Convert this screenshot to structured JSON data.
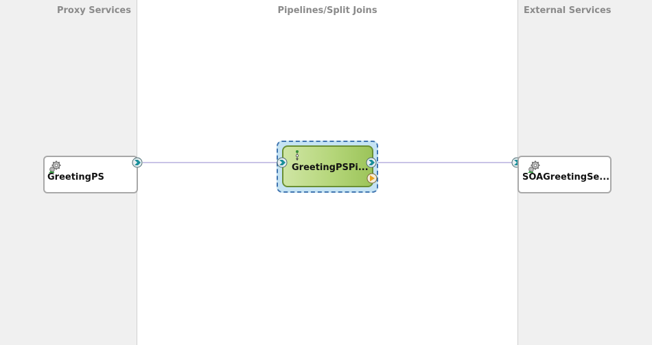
{
  "lanes": {
    "proxy_title": "Proxy Services",
    "pipelines_title": "Pipelines/Split Joins",
    "external_title": "External Services"
  },
  "proxy_service": {
    "name": "GreetingPS",
    "icon": "gear-icon"
  },
  "pipeline": {
    "name": "GreetingPSPi...",
    "icon": "pipeline-icon"
  },
  "external_service": {
    "name": "SOAGreetingSe...",
    "icon": "gear-icon"
  },
  "colors": {
    "lane_bg": "#f0f0f0",
    "canvas_bg": "#ffffff",
    "wire": "#c9c3e6",
    "pipeline_fill": "#b5d67a",
    "selection_fill": "#c5e3f3",
    "selection_border": "#3f74b0",
    "port_teal": "#1a8f9a",
    "port_orange": "#e8a21e"
  }
}
